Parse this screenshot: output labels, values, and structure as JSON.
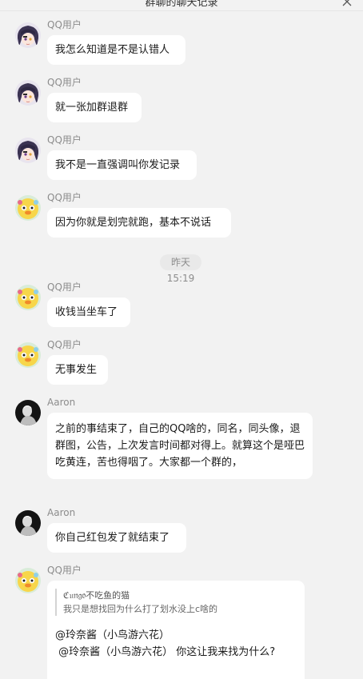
{
  "window": {
    "title": "群聊的聊天记录",
    "close_icon": "close-icon"
  },
  "time_divider": "昨天 15:19",
  "messages": [
    {
      "name": "QQ用户",
      "avatar": "anime-girl",
      "text": "我怎么知道是不是认错人"
    },
    {
      "name": "QQ用户",
      "avatar": "anime-girl",
      "text": "就一张加群退群"
    },
    {
      "name": "QQ用户",
      "avatar": "anime-girl",
      "text": "我不是一直强调叫你发记录"
    },
    {
      "name": "QQ用户",
      "avatar": "yellow-chick",
      "text": "因为你就是划完就跑，基本不说话"
    },
    {
      "name": "QQ用户",
      "avatar": "yellow-chick",
      "text": "收钱当坐车了"
    },
    {
      "name": "QQ用户",
      "avatar": "yellow-chick",
      "text": "无事发生"
    },
    {
      "name": "Aaron",
      "avatar": "dark-figure",
      "text": "之前的事结束了，自己的QQ啥的，同名，同头像，退群图，公告，上次发言时间都对得上。就算这个是哑巴吃黄连，苦也得咽了。大家都一个群的，"
    },
    {
      "name": "Aaron",
      "avatar": "dark-figure",
      "text": "你自己红包发了就结束了"
    },
    {
      "name": "QQ用户",
      "avatar": "yellow-chick",
      "quote_author": "ℭ𝔲𝔫𝔤𝔬不吃鱼的猫",
      "quote_text": "我只是想找回为什么打了划水没上c啥的",
      "line1": "@玲奈酱（小鸟游六花）",
      "line2": " @玲奈酱（小鸟游六花） 你这让我来找为什么?"
    }
  ],
  "colors": {
    "background": "#f2f2f2",
    "bubble": "#ffffff",
    "name_gray": "#8c8c8c"
  }
}
